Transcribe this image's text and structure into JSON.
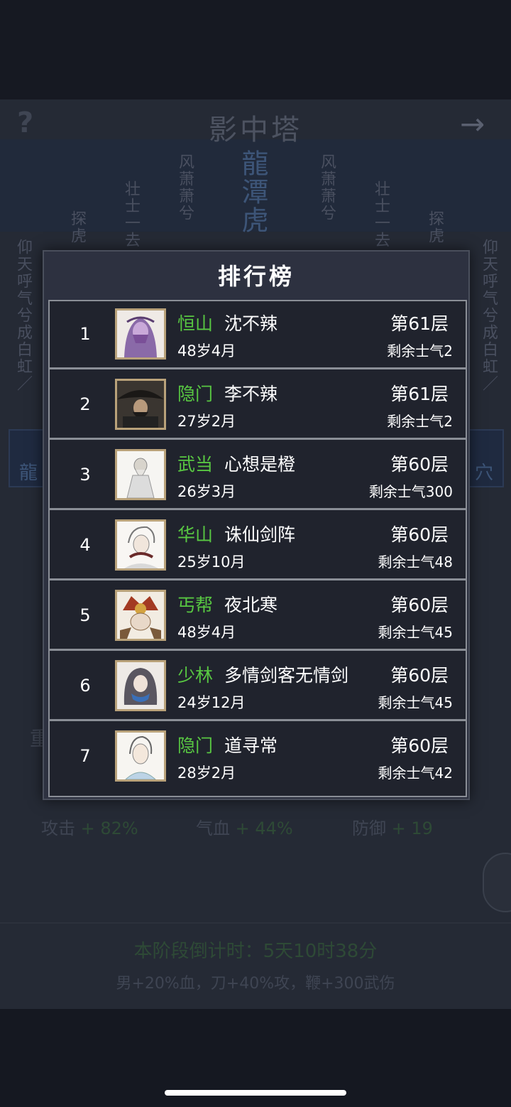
{
  "background": {
    "title": "影中塔",
    "help_icon": "?",
    "arrow_icon": "→",
    "columns": [
      {
        "text": "仰天呼气兮成白虹／"
      },
      {
        "text": "探虎"
      },
      {
        "text": "壮士一去"
      },
      {
        "text": "风萧萧兮"
      },
      {
        "text": "龍潭虎"
      },
      {
        "text": "风萧萧兮"
      },
      {
        "text": "壮士一去"
      },
      {
        "text": "探虎"
      },
      {
        "text": "仰天呼气兮成白虹／"
      }
    ],
    "left_box": "龍",
    "right_box": "穴",
    "left_char": "重",
    "stats": [
      {
        "label": "攻击",
        "value": "+ 82%"
      },
      {
        "label": "气血",
        "value": "+ 44%"
      },
      {
        "label": "防御",
        "value": "+ 19"
      }
    ],
    "countdown": "本阶段倒计时：5天10时38分",
    "bonus": "男+20%血，刀+40%攻，鞭+300武伤"
  },
  "leaderboard": {
    "title": "排行榜",
    "rows": [
      {
        "rank": "1",
        "sect": "恒山",
        "name": "沈不辣",
        "age": "48岁4月",
        "floor": "第61层",
        "morale": "剩余士气2",
        "avatar": "purple-masked-portrait"
      },
      {
        "rank": "2",
        "sect": "隐门",
        "name": "李不辣",
        "age": "27岁2月",
        "floor": "第61层",
        "morale": "剩余士气2",
        "avatar": "straw-hat-portrait"
      },
      {
        "rank": "3",
        "sect": "武当",
        "name": "心想是橙",
        "age": "26岁3月",
        "floor": "第60层",
        "morale": "剩余士气300",
        "avatar": "old-sage-portrait"
      },
      {
        "rank": "4",
        "sect": "华山",
        "name": "诛仙剑阵",
        "age": "25岁10月",
        "floor": "第60层",
        "morale": "剩余士气48",
        "avatar": "white-hair-portrait"
      },
      {
        "rank": "5",
        "sect": "丐帮",
        "name": "夜北寒",
        "age": "48岁4月",
        "floor": "第60层",
        "morale": "剩余士气45",
        "avatar": "armored-warrior-portrait"
      },
      {
        "rank": "6",
        "sect": "少林",
        "name": "多情剑客无情剑",
        "age": "24岁12月",
        "floor": "第60层",
        "morale": "剩余士气45",
        "avatar": "scarf-swordsman-portrait"
      },
      {
        "rank": "7",
        "sect": "隐门",
        "name": "道寻常",
        "age": "28岁2月",
        "floor": "第60层",
        "morale": "剩余士气42",
        "avatar": "young-scholar-portrait"
      }
    ]
  },
  "colors": {
    "sect_green": "#58c742",
    "modal_bg": "#2d3140",
    "list_bg": "#20232d",
    "divider": "#8a8e96"
  }
}
